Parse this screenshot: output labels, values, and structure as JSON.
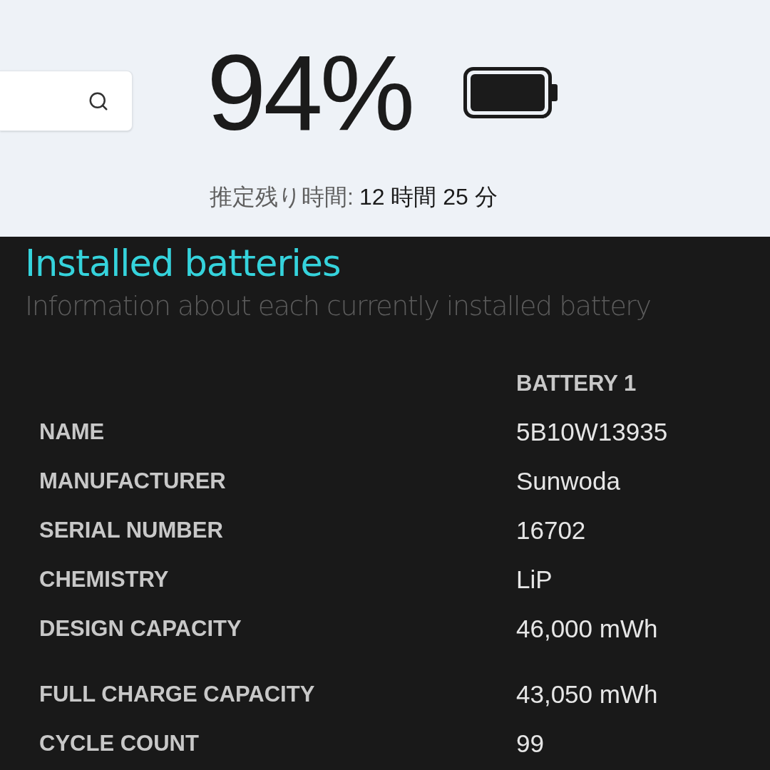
{
  "battery": {
    "percent": "94%",
    "estimate_label": "推定残り時間:",
    "estimate_value": "12 時間 25 分"
  },
  "installed": {
    "title": "Installed batteries",
    "subtitle": "Information about each currently installed battery",
    "column_header": "BATTERY 1",
    "groups": [
      [
        {
          "label": "NAME",
          "value": "5B10W13935"
        },
        {
          "label": "MANUFACTURER",
          "value": "Sunwoda"
        },
        {
          "label": "SERIAL NUMBER",
          "value": "16702"
        },
        {
          "label": "CHEMISTRY",
          "value": "LiP"
        },
        {
          "label": "DESIGN CAPACITY",
          "value": "46,000 mWh"
        }
      ],
      [
        {
          "label": "FULL CHARGE CAPACITY",
          "value": "43,050 mWh"
        },
        {
          "label": "CYCLE COUNT",
          "value": "99"
        }
      ]
    ]
  }
}
